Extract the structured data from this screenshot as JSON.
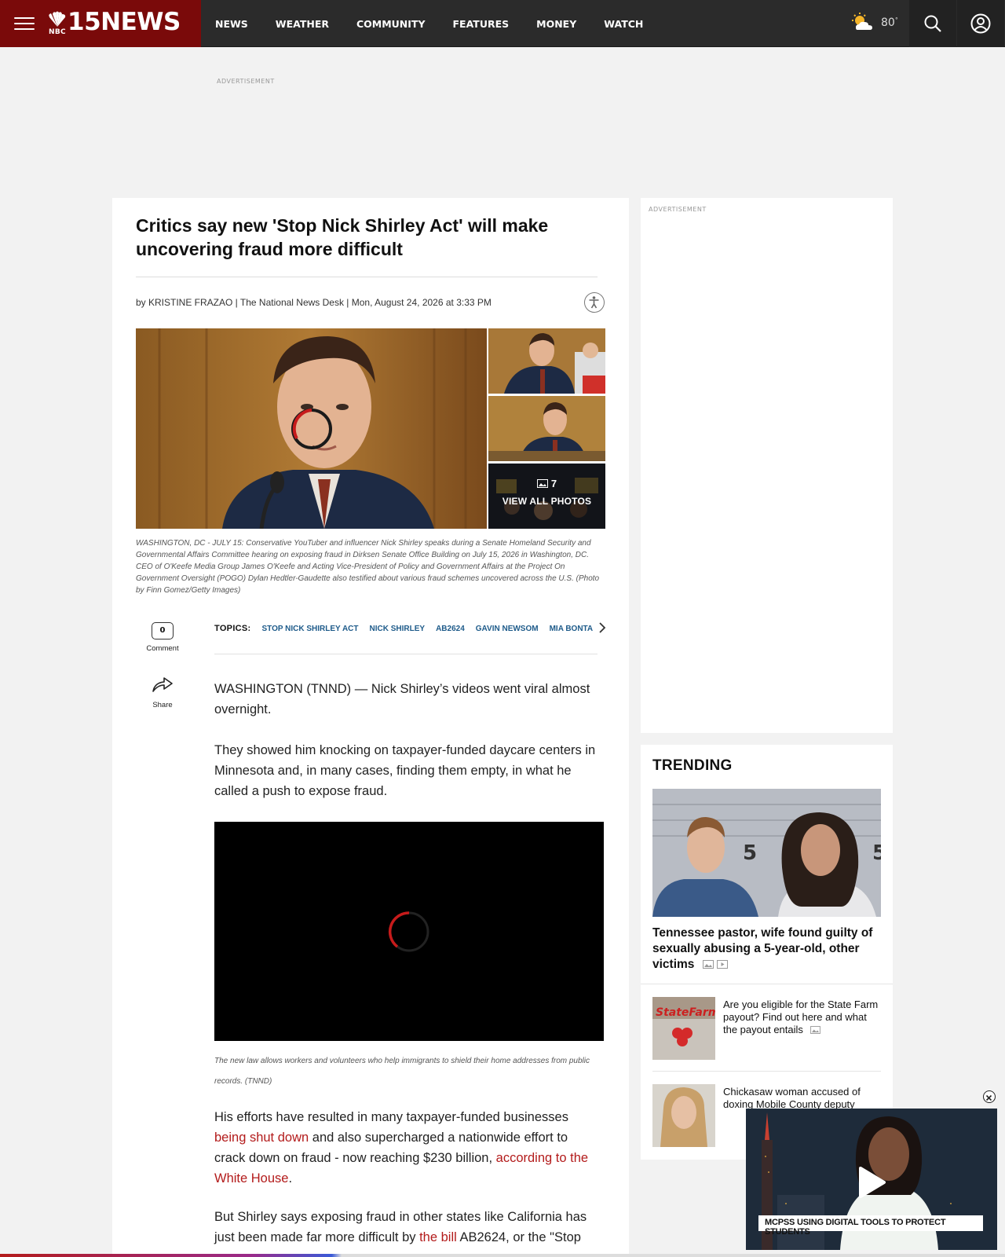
{
  "header": {
    "brand_name": "15NEWS",
    "brand_network": "NBC",
    "nav": [
      "NEWS",
      "WEATHER",
      "COMMUNITY",
      "FEATURES",
      "MONEY",
      "WATCH"
    ],
    "weather_temp": "80",
    "weather_deg": "°"
  },
  "ads": {
    "top_label": "ADVERTISEMENT",
    "side_label": "ADVERTISEMENT"
  },
  "article": {
    "headline": "Critics say new 'Stop Nick Shirley Act' will make uncovering fraud more difficult",
    "byline": "by KRISTINE FRAZAO | The National News Desk | Mon, August 24, 2026 at 3:33 PM",
    "gallery": {
      "count": "7",
      "view_all": "VIEW ALL PHOTOS"
    },
    "caption": "WASHINGTON, DC - JULY 15: Conservative YouTuber and influencer Nick Shirley speaks during a Senate Homeland Security and Governmental Affairs Committee hearing on exposing fraud in Dirksen Senate Office Building on July 15, 2026 in Washington, DC. CEO of O'Keefe Media Group James O'Keefe and Acting Vice-President of Policy and Government Affairs at the Project On Government Oversight (POGO) Dylan Hedtler-Gaudette also testified about various fraud schemes uncovered across the U.S. (Photo by Finn Gomez/Getty Images)",
    "comment_count": "0",
    "comment_label": "Comment",
    "share_label": "Share",
    "topics_label": "TOPICS:",
    "topics": [
      "STOP NICK SHIRLEY ACT",
      "NICK SHIRLEY",
      "AB2624",
      "GAVIN NEWSOM",
      "MIA BONTA"
    ],
    "p1": "WASHINGTON (TNND) — Nick Shirley’s videos went viral almost overnight.",
    "p2": "They showed him knocking on taxpayer-funded daycare centers in Minnesota and, in many cases, finding them empty, in what he called a push to expose fraud.",
    "video_caption": "The new law allows workers and volunteers who help immigrants to shield their home addresses from public records. (TNND)",
    "p3": {
      "a": "His efforts have resulted in many taxpayer-funded businesses ",
      "link1": "being shut down",
      "b": " and also supercharged a nationwide effort to crack down on fraud - now reaching $230 billion, ",
      "link2": "according to the White House",
      "c": "."
    },
    "p4": {
      "a": "But Shirley says exposing fraud in other states like California has just been made far more difficult by ",
      "link": "the bill",
      "b": " AB2624, or the \"Stop"
    }
  },
  "trending": {
    "title": "TRENDING",
    "lead_title": "Tennessee pastor, wife found guilty of sexually abusing a 5-year-old, other victims",
    "items": [
      {
        "title": "Are you eligible for the State Farm payout? Find out here and what the payout entails"
      },
      {
        "title": "Chickasaw woman accused of doxing Mobile County deputy"
      }
    ]
  },
  "floating_video": {
    "ticker": "MCPSS USING DIGITAL TOOLS TO PROTECT STUDENTS"
  }
}
